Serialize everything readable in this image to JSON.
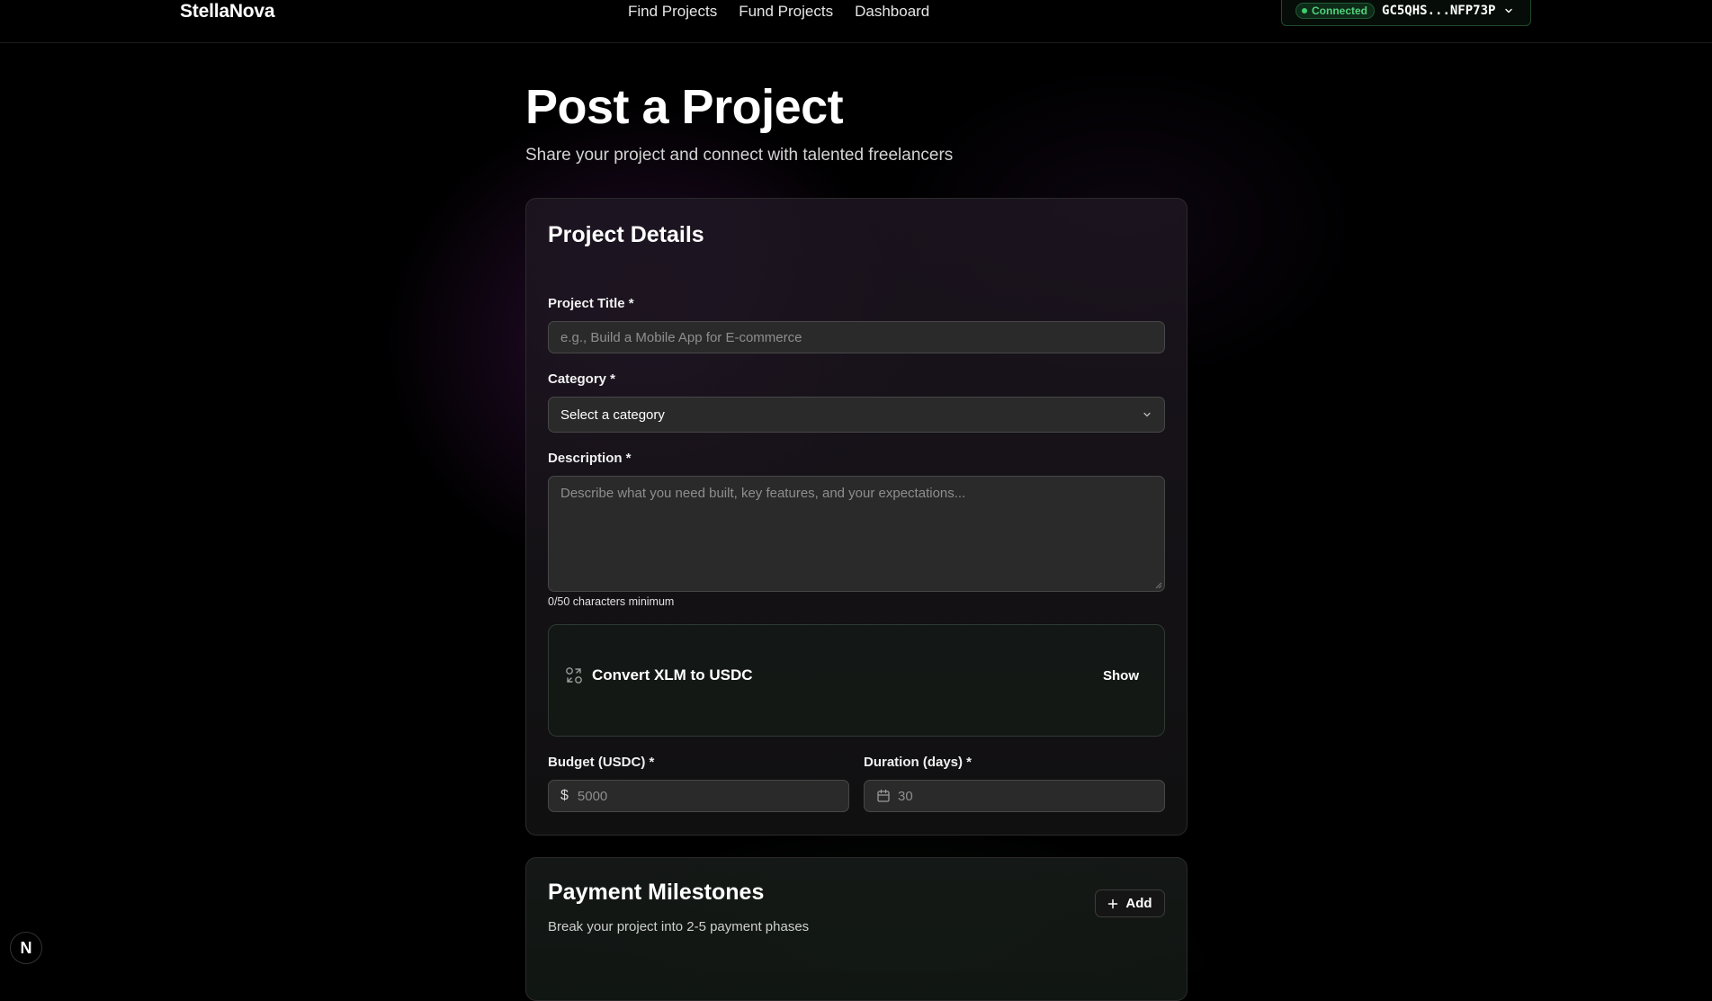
{
  "header": {
    "logo": "StellaNova",
    "nav": [
      "Find Projects",
      "Fund Projects",
      "Dashboard"
    ],
    "wallet": {
      "status": "Connected",
      "address": "GC5QHS...NFP73P",
      "status_color": "#3fcf6e"
    }
  },
  "page": {
    "title": "Post a Project",
    "subtitle": "Share your project and connect with talented freelancers"
  },
  "project_details": {
    "title": "Project Details",
    "project_title": {
      "label": "Project Title *",
      "placeholder": "e.g., Build a Mobile App for E-commerce",
      "value": ""
    },
    "category": {
      "label": "Category *",
      "selected": "Select a category"
    },
    "description": {
      "label": "Description *",
      "placeholder": "Describe what you need built, key features, and your expectations...",
      "value": "",
      "helper": "0/50 characters minimum"
    },
    "convert": {
      "title": "Convert XLM to USDC",
      "toggle_label": "Show"
    },
    "budget": {
      "label": "Budget (USDC) *",
      "prefix": "$",
      "placeholder": "5000",
      "value": ""
    },
    "duration": {
      "label": "Duration (days) *",
      "placeholder": "30",
      "value": ""
    }
  },
  "milestones": {
    "title": "Payment Milestones",
    "subtitle": "Break your project into 2-5 payment phases",
    "add_label": "Add"
  },
  "dev_badge": {
    "letter": "N"
  },
  "icons": {
    "wallet_dropdown": "chevron-down-icon",
    "category_dropdown": "chevron-down-icon",
    "convert": "exchange-icon",
    "duration": "calendar-icon",
    "add": "plus-icon"
  }
}
